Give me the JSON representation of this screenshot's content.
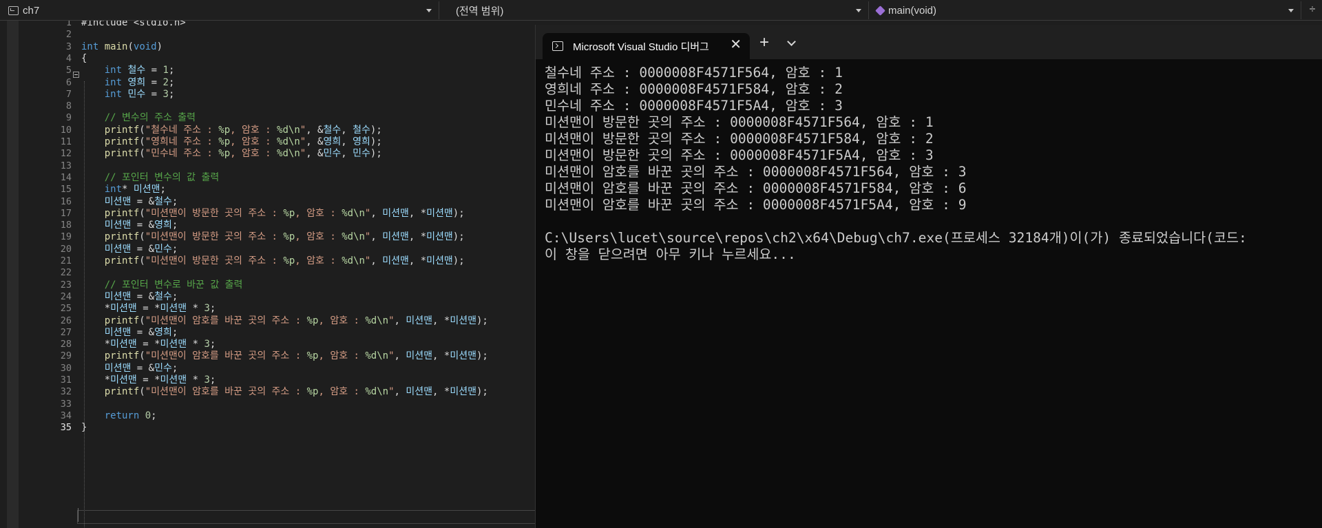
{
  "navbar": {
    "project": "ch7",
    "scope": "(전역 범위)",
    "function": "main(void)"
  },
  "editor": {
    "lines": [
      {
        "n": "1",
        "html": "<span class='punct'>#include &lt;stdio.h&gt;</span>"
      },
      {
        "n": "2",
        "html": ""
      },
      {
        "n": "3",
        "html": "<span class='kw'>int</span> <span class='fn'>main</span>(<span class='kw'>void</span>)"
      },
      {
        "n": "4",
        "html": "{"
      },
      {
        "n": "5",
        "html": "    <span class='kw'>int</span> <span class='var'>철수</span> = <span class='num'>1</span>;"
      },
      {
        "n": "6",
        "html": "    <span class='kw'>int</span> <span class='var'>영희</span> = <span class='num'>2</span>;"
      },
      {
        "n": "7",
        "html": "    <span class='kw'>int</span> <span class='var'>민수</span> = <span class='num'>3</span>;"
      },
      {
        "n": "8",
        "html": ""
      },
      {
        "n": "9",
        "html": "    <span class='cm'>// 변수의 주소 출력</span>"
      },
      {
        "n": "10",
        "html": "    <span class='fn'>printf</span>(<span class='str'>\"철수네 주소 : </span><span class='fmt'>%p</span><span class='str'>, 암호 : </span><span class='fmt'>%d\\n</span><span class='str'>\"</span>, &amp;<span class='var'>철수</span>, <span class='var'>철수</span>);"
      },
      {
        "n": "11",
        "html": "    <span class='fn'>printf</span>(<span class='str'>\"영희네 주소 : </span><span class='fmt'>%p</span><span class='str'>, 암호 : </span><span class='fmt'>%d\\n</span><span class='str'>\"</span>, &amp;<span class='var'>영희</span>, <span class='var'>영희</span>);"
      },
      {
        "n": "12",
        "html": "    <span class='fn'>printf</span>(<span class='str'>\"민수네 주소 : </span><span class='fmt'>%p</span><span class='str'>, 암호 : </span><span class='fmt'>%d\\n</span><span class='str'>\"</span>, &amp;<span class='var'>민수</span>, <span class='var'>민수</span>);"
      },
      {
        "n": "13",
        "html": ""
      },
      {
        "n": "14",
        "html": "    <span class='cm'>// 포인터 변수의 값 출력</span>"
      },
      {
        "n": "15",
        "html": "    <span class='kw'>int</span>* <span class='var'>미션맨</span>;"
      },
      {
        "n": "16",
        "html": "    <span class='var'>미션맨</span> = &amp;<span class='var'>철수</span>;"
      },
      {
        "n": "17",
        "html": "    <span class='fn'>printf</span>(<span class='str'>\"미션맨이 방문한 곳의 주소 : </span><span class='fmt'>%p</span><span class='str'>, 암호 : </span><span class='fmt'>%d\\n</span><span class='str'>\"</span>, <span class='var'>미션맨</span>, *<span class='var'>미션맨</span>);"
      },
      {
        "n": "18",
        "html": "    <span class='var'>미션맨</span> = &amp;<span class='var'>영희</span>;"
      },
      {
        "n": "19",
        "html": "    <span class='fn'>printf</span>(<span class='str'>\"미션맨이 방문한 곳의 주소 : </span><span class='fmt'>%p</span><span class='str'>, 암호 : </span><span class='fmt'>%d\\n</span><span class='str'>\"</span>, <span class='var'>미션맨</span>, *<span class='var'>미션맨</span>);"
      },
      {
        "n": "20",
        "html": "    <span class='var'>미션맨</span> = &amp;<span class='var'>민수</span>;"
      },
      {
        "n": "21",
        "html": "    <span class='fn'>printf</span>(<span class='str'>\"미션맨이 방문한 곳의 주소 : </span><span class='fmt'>%p</span><span class='str'>, 암호 : </span><span class='fmt'>%d\\n</span><span class='str'>\"</span>, <span class='var'>미션맨</span>, *<span class='var'>미션맨</span>);"
      },
      {
        "n": "22",
        "html": ""
      },
      {
        "n": "23",
        "html": "    <span class='cm'>// 포인터 변수로 바꾼 값 출력</span>"
      },
      {
        "n": "24",
        "html": "    <span class='var'>미션맨</span> = &amp;<span class='var'>철수</span>;"
      },
      {
        "n": "25",
        "html": "    *<span class='var'>미션맨</span> = *<span class='var'>미션맨</span> * <span class='num'>3</span>;"
      },
      {
        "n": "26",
        "html": "    <span class='fn'>printf</span>(<span class='str'>\"미션맨이 암호를 바꾼 곳의 주소 : </span><span class='fmt'>%p</span><span class='str'>, 암호 : </span><span class='fmt'>%d\\n</span><span class='str'>\"</span>, <span class='var'>미션맨</span>, *<span class='var'>미션맨</span>);"
      },
      {
        "n": "27",
        "html": "    <span class='var'>미션맨</span> = &amp;<span class='var'>영희</span>;"
      },
      {
        "n": "28",
        "html": "    *<span class='var'>미션맨</span> = *<span class='var'>미션맨</span> * <span class='num'>3</span>;"
      },
      {
        "n": "29",
        "html": "    <span class='fn'>printf</span>(<span class='str'>\"미션맨이 암호를 바꾼 곳의 주소 : </span><span class='fmt'>%p</span><span class='str'>, 암호 : </span><span class='fmt'>%d\\n</span><span class='str'>\"</span>, <span class='var'>미션맨</span>, *<span class='var'>미션맨</span>);"
      },
      {
        "n": "30",
        "html": "    <span class='var'>미션맨</span> = &amp;<span class='var'>민수</span>;"
      },
      {
        "n": "31",
        "html": "    *<span class='var'>미션맨</span> = *<span class='var'>미션맨</span> * <span class='num'>3</span>;"
      },
      {
        "n": "32",
        "html": "    <span class='fn'>printf</span>(<span class='str'>\"미션맨이 암호를 바꾼 곳의 주소 : </span><span class='fmt'>%p</span><span class='str'>, 암호 : </span><span class='fmt'>%d\\n</span><span class='str'>\"</span>, <span class='var'>미션맨</span>, *<span class='var'>미션맨</span>);"
      },
      {
        "n": "33",
        "html": ""
      },
      {
        "n": "34",
        "html": "    <span class='kw'>return</span> <span class='num'>0</span>;"
      },
      {
        "n": "35",
        "html": "}"
      }
    ]
  },
  "console": {
    "tab_title": "Microsoft Visual Studio 디버그",
    "close_glyph": "✕",
    "new_tab_glyph": "+",
    "output": [
      "철수네 주소 : 0000008F4571F564, 암호 : 1",
      "영희네 주소 : 0000008F4571F584, 암호 : 2",
      "민수네 주소 : 0000008F4571F5A4, 암호 : 3",
      "미션맨이 방문한 곳의 주소 : 0000008F4571F564, 암호 : 1",
      "미션맨이 방문한 곳의 주소 : 0000008F4571F584, 암호 : 2",
      "미션맨이 방문한 곳의 주소 : 0000008F4571F5A4, 암호 : 3",
      "미션맨이 암호를 바꾼 곳의 주소 : 0000008F4571F564, 암호 : 3",
      "미션맨이 암호를 바꾼 곳의 주소 : 0000008F4571F584, 암호 : 6",
      "미션맨이 암호를 바꾼 곳의 주소 : 0000008F4571F5A4, 암호 : 9",
      "",
      "C:\\Users\\lucet\\source\\repos\\ch2\\x64\\Debug\\ch7.exe(프로세스 32184개)이(가) 종료되었습니다(코드:",
      "이 창을 닫으려면 아무 키나 누르세요..."
    ]
  },
  "colors": {
    "editor_bg": "#1e1e1e",
    "console_bg": "#0c0c0c",
    "keyword": "#569cd6",
    "string": "#d69d85",
    "comment": "#57a64a",
    "variable": "#9cdcfe"
  },
  "icons": {
    "project": "project-icon",
    "function": "cube-icon",
    "split": "split-editor-icon",
    "terminal": "terminal-icon"
  }
}
